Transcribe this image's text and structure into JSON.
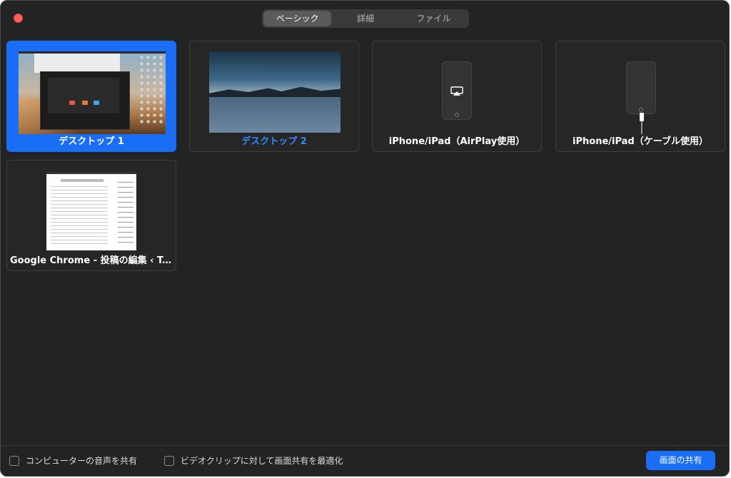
{
  "tabs": [
    {
      "label": "ベーシック",
      "active": true
    },
    {
      "label": "詳細",
      "active": false
    },
    {
      "label": "ファイル",
      "active": false
    }
  ],
  "tiles": [
    {
      "label": "デスクトップ 1",
      "selected": true
    },
    {
      "label": "デスクトップ 2",
      "selected": false
    },
    {
      "label": "iPhone/iPad（AirPlay使用）",
      "selected": false
    },
    {
      "label": "iPhone/iPad（ケーブル使用）",
      "selected": false
    },
    {
      "label": "Google Chrome - 投稿の編集 ‹ T-ST...",
      "selected": false
    }
  ],
  "options": {
    "computer_audio": "コンピューターの音声を共有",
    "optimize_video": "ビデオクリップに対して画面共有を最適化"
  },
  "share_button": "画面の共有",
  "colors": {
    "accent": "#1a6ef5",
    "close": "#fe5f57",
    "window_bg": "#232323"
  }
}
